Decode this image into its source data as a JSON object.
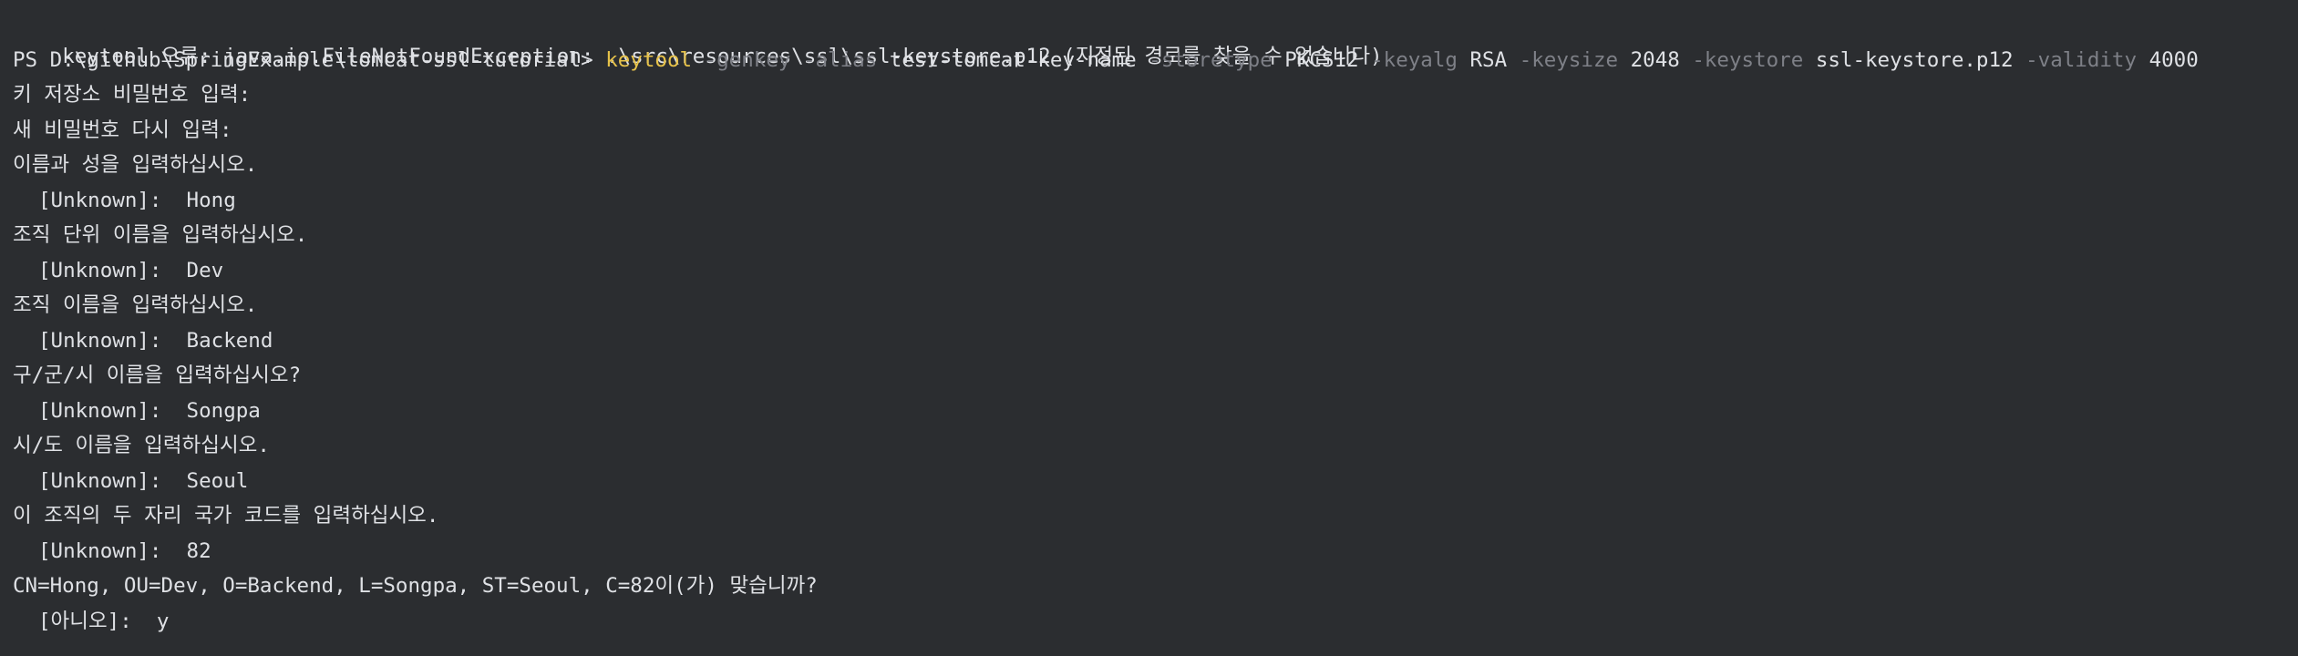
{
  "terminal": {
    "error_line": "keytool 오류: java.io.FileNotFoundException: .\\src\\resources\\ssl\\ssl-keystore.p12 (지정된 경로를 찾을 수 없습니다)",
    "prompt": "PS D:\\github\\SpringExample\\tomcat-ssl-tutorial>",
    "command": {
      "name": "keytool",
      "flag_genkey": "-genkey",
      "flag_alias": "-alias",
      "alias": "test-tomcat-key-name",
      "flag_storetype": "-storetype",
      "storetype": "PKCS12",
      "flag_keyalg": "-keyalg",
      "keyalg": "RSA",
      "flag_keysize": "-keysize",
      "keysize": "2048",
      "flag_keystore": "-keystore",
      "keystore": "ssl-keystore.p12",
      "flag_validity": "-validity",
      "validity": "4000"
    },
    "lines": [
      "키 저장소 비밀번호 입력:",
      "새 비밀번호 다시 입력:",
      "이름과 성을 입력하십시오.",
      "[Unknown]:  Hong",
      "조직 단위 이름을 입력하십시오.",
      "[Unknown]:  Dev",
      "조직 이름을 입력하십시오.",
      "[Unknown]:  Backend",
      "구/군/시 이름을 입력하십시오?",
      "[Unknown]:  Songpa",
      "시/도 이름을 입력하십시오.",
      "[Unknown]:  Seoul",
      "이 조직의 두 자리 국가 코드를 입력하십시오.",
      "[Unknown]:  82",
      "CN=Hong, OU=Dev, O=Backend, L=Songpa, ST=Seoul, C=82이(가) 맞습니까?",
      "[아니오]:  y"
    ]
  }
}
